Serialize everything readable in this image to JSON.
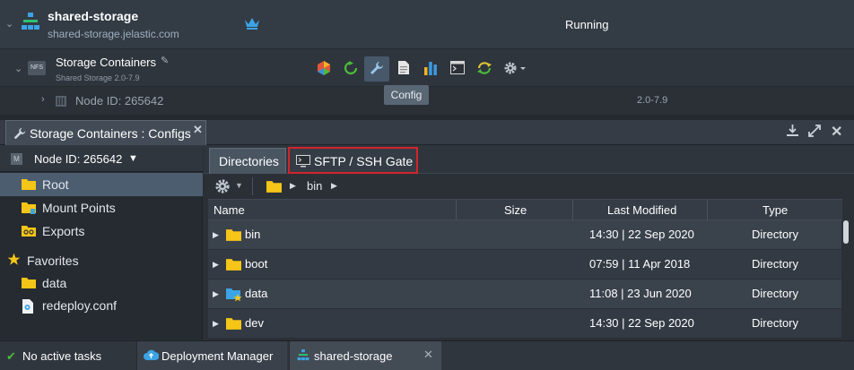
{
  "environment": {
    "name": "shared-storage",
    "domain": "shared-storage.jelastic.com",
    "status": "Running"
  },
  "node_group": {
    "badge": "NFS",
    "title": "Storage Containers",
    "subtitle": "Shared Storage 2.0-7.9",
    "toolbar": [
      {
        "icon": "add-ons-icon",
        "color": "#e0563b"
      },
      {
        "icon": "restart-icon",
        "color": "#4cbb3a"
      },
      {
        "icon": "config-wrench-icon",
        "color": "#7fb3e0",
        "active": true
      },
      {
        "icon": "log-file-icon",
        "color": "#e6e6e6"
      },
      {
        "icon": "statistics-icon",
        "color": "#3b9be0"
      },
      {
        "icon": "web-ssh-icon",
        "color": "#d6d6d6"
      },
      {
        "icon": "redeploy-icon",
        "color": "#d7c533"
      },
      {
        "icon": "settings-gear-icon",
        "color": "#bfc6cd"
      }
    ]
  },
  "node": {
    "label": "Node ID: 265642",
    "version": "2.0-7.9"
  },
  "tooltip": "Config",
  "panel": {
    "tab_title": "Storage Containers : Configs"
  },
  "sidebar": {
    "node_selector": "Node ID: 265642",
    "items": [
      {
        "label": "Root",
        "selected": true
      },
      {
        "label": "Mount Points"
      },
      {
        "label": "Exports"
      }
    ],
    "favorites_label": "Favorites",
    "favorites": [
      {
        "label": "data"
      },
      {
        "label": "redeploy.conf"
      }
    ]
  },
  "main": {
    "tabs": [
      {
        "label": "Directories",
        "active": true
      },
      {
        "label": "SFTP / SSH Gate",
        "highlighted": true
      }
    ],
    "breadcrumb": [
      "bin"
    ],
    "columns": [
      "Name",
      "Size",
      "Last Modified",
      "Type"
    ],
    "rows": [
      {
        "name": "bin",
        "size": "",
        "modified": "14:30 | 22 Sep 2020",
        "type": "Directory"
      },
      {
        "name": "boot",
        "size": "",
        "modified": "07:59 | 11 Apr 2018",
        "type": "Directory"
      },
      {
        "name": "data",
        "size": "",
        "modified": "11:08 | 23 Jun 2020",
        "type": "Directory",
        "favorite": true
      },
      {
        "name": "dev",
        "size": "",
        "modified": "14:30 | 22 Sep 2020",
        "type": "Directory"
      }
    ]
  },
  "bottombar": {
    "tasks": "No active tasks",
    "deployment_manager": "Deployment Manager",
    "env_tab": "shared-storage"
  },
  "colors": {
    "accent_blue": "#4c5d70",
    "folder": "#f5c518",
    "highlight_red": "#d3242c"
  }
}
